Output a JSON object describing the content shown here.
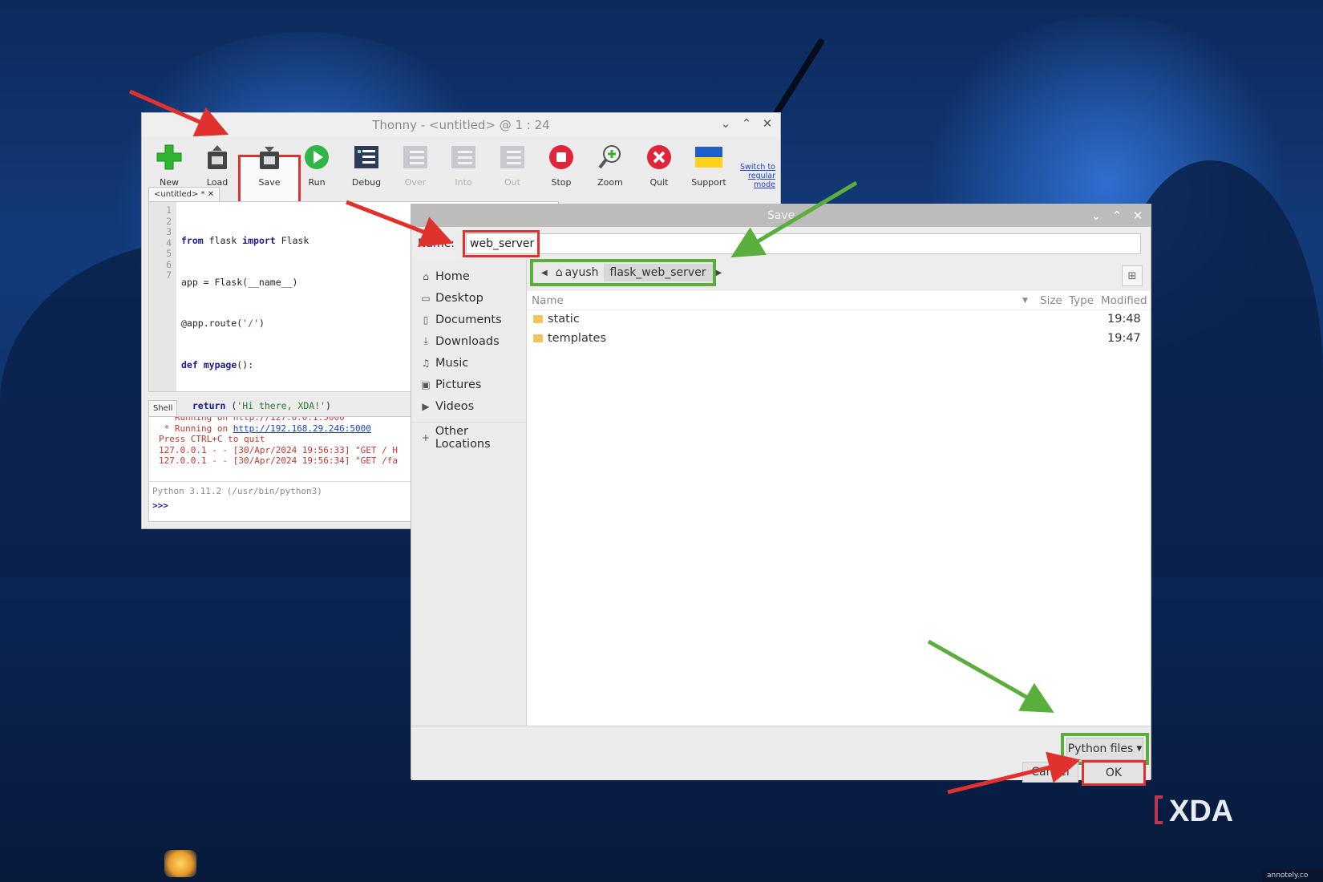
{
  "thonny": {
    "title": "Thonny  -  <untitled>  @  1 : 24",
    "toolbar": [
      {
        "label": "New",
        "icon": "new-plus-icon",
        "enabled": true
      },
      {
        "label": "Load",
        "icon": "load-icon",
        "enabled": true
      },
      {
        "label": "Save",
        "icon": "save-icon",
        "enabled": true
      },
      {
        "label": "Run",
        "icon": "run-play-icon",
        "enabled": true
      },
      {
        "label": "Debug",
        "icon": "debug-icon",
        "enabled": true
      },
      {
        "label": "Over",
        "icon": "step-over-icon",
        "enabled": false
      },
      {
        "label": "Into",
        "icon": "step-into-icon",
        "enabled": false
      },
      {
        "label": "Out",
        "icon": "step-out-icon",
        "enabled": false
      },
      {
        "label": "Stop",
        "icon": "stop-icon",
        "enabled": true
      },
      {
        "label": "Zoom",
        "icon": "zoom-icon",
        "enabled": true
      },
      {
        "label": "Quit",
        "icon": "quit-icon",
        "enabled": true
      },
      {
        "label": "Support",
        "icon": "ukraine-flag-icon",
        "enabled": true
      }
    ],
    "switch_mode_label": "Switch to regular mode",
    "editor_tab": "<untitled> * ✕",
    "line_numbers": [
      "1",
      "2",
      "3",
      "4",
      "5",
      "6",
      "7"
    ],
    "shell_tab": "Shell",
    "shell_lines": {
      "truncated": "   Running on http://127.0.0.1:5000",
      "running_prefix": " * Running on ",
      "running_url": "http://192.168.29.246:5000",
      "quit_hint": "Press CTRL+C to quit",
      "log1": "127.0.0.1 - - [30/Apr/2024 19:56:33] \"GET / H",
      "log2": "127.0.0.1 - - [30/Apr/2024 19:56:34] \"GET /fa"
    },
    "python_version": "Python 3.11.2 (/usr/bin/python3)",
    "prompt": ">>>"
  },
  "dialog": {
    "title": "Save",
    "name_label": "Name:",
    "name_value": "web_server",
    "places": [
      {
        "label": "Home",
        "icon": "home-icon"
      },
      {
        "label": "Desktop",
        "icon": "desktop-folder-icon"
      },
      {
        "label": "Documents",
        "icon": "documents-icon"
      },
      {
        "label": "Downloads",
        "icon": "downloads-icon"
      },
      {
        "label": "Music",
        "icon": "music-icon"
      },
      {
        "label": "Pictures",
        "icon": "pictures-icon"
      },
      {
        "label": "Videos",
        "icon": "videos-icon"
      }
    ],
    "other_locations": "Other Locations",
    "path": {
      "home": "ayush",
      "current": "flask_web_server"
    },
    "columns": {
      "name": "Name",
      "size": "Size",
      "type": "Type",
      "modified": "Modified"
    },
    "files": [
      {
        "name": "static",
        "modified": "19:48"
      },
      {
        "name": "templates",
        "modified": "19:47"
      }
    ],
    "filter": "Python files",
    "cancel": "Cancel",
    "ok": "OK"
  },
  "watermark": {
    "text": "annotely.co",
    "logo": "XDA"
  },
  "colors": {
    "highlight_red": "#e0312e",
    "highlight_green": "#5aaf3c"
  }
}
